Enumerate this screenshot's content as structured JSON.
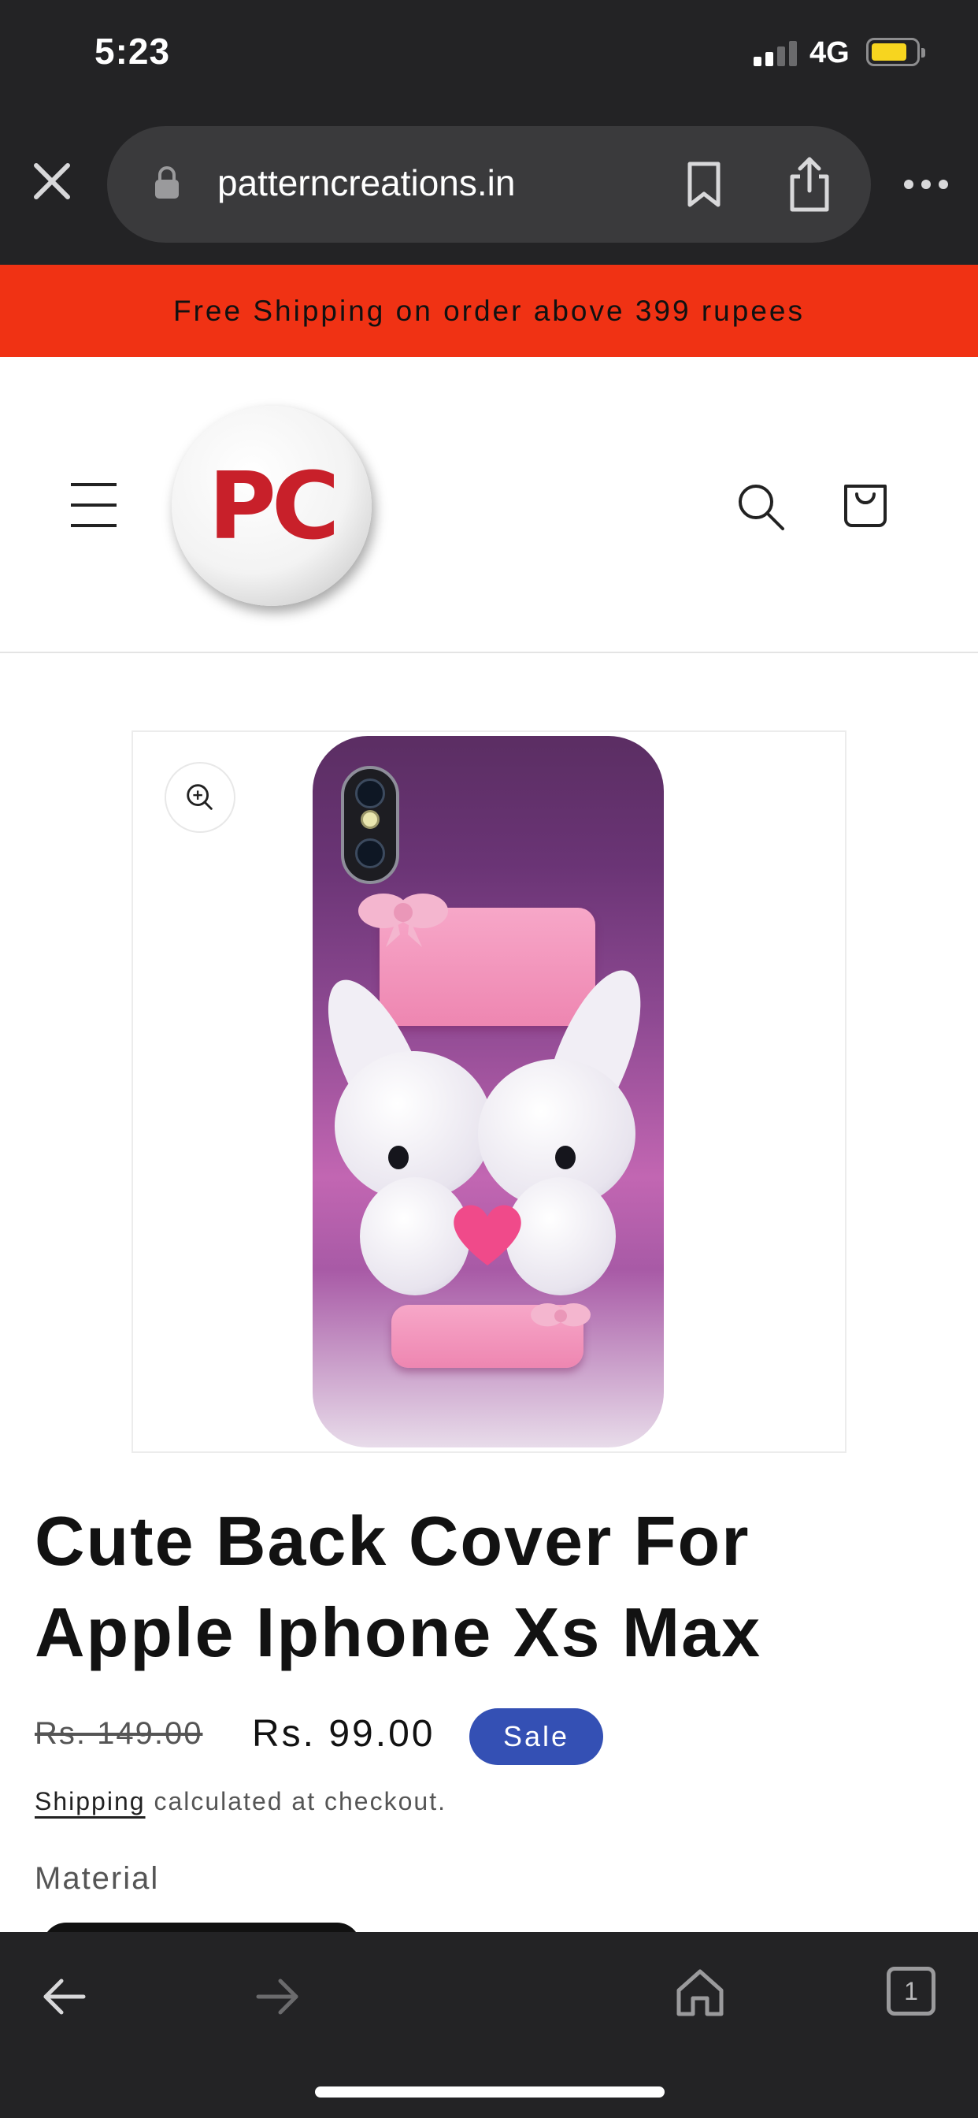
{
  "status_bar": {
    "time": "5:23",
    "network": "4G",
    "battery_color": "#f7d51f"
  },
  "browser": {
    "url": "patterncreations.in",
    "icons": [
      "close-icon",
      "lock-icon",
      "bookmark-icon",
      "share-icon",
      "more-icon"
    ]
  },
  "announcement": {
    "text": "Free Shipping on order above 399 rupees",
    "background": "#f03214"
  },
  "header": {
    "logo_text": "PC",
    "logo_color": "#c8202a",
    "icons": [
      "menu-icon",
      "search-icon",
      "cart-icon"
    ]
  },
  "product": {
    "title": "Cute Back Cover For Apple Iphone Xs Max",
    "price_regular": "Rs. 149.00",
    "price_sale": "Rs. 99.00",
    "sale_badge": "Sale",
    "sale_badge_color": "#3450b4",
    "shipping_link": "Shipping",
    "shipping_rest": " calculated at checkout.",
    "material_label": "Material"
  },
  "bottom_toolbar": {
    "tab_count": "1",
    "icons": [
      "back-arrow-icon",
      "forward-arrow-icon",
      "home-icon",
      "tabs-icon"
    ]
  }
}
